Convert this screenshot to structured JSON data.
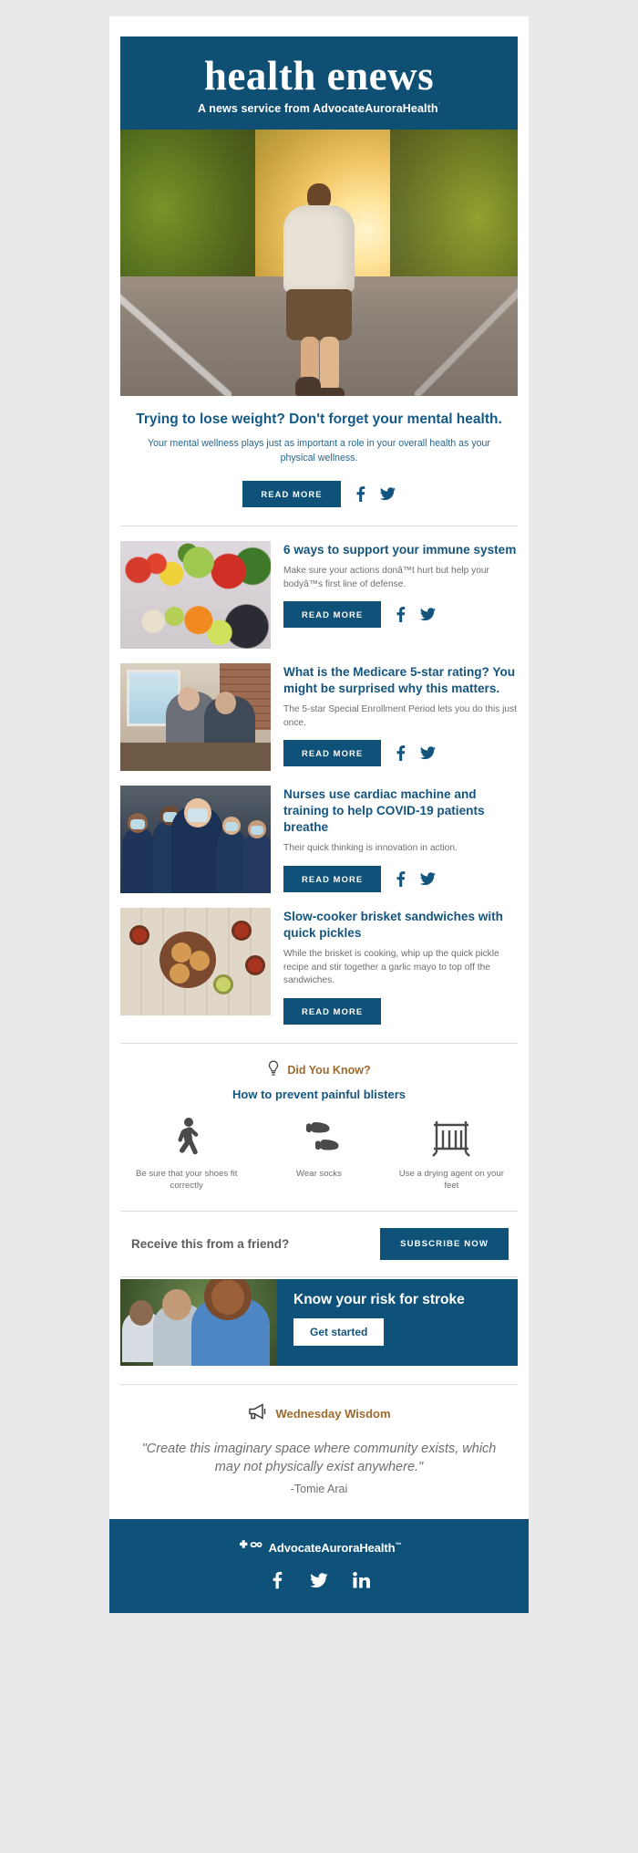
{
  "masthead": {
    "title": "health enews",
    "subtitle_prefix": "A news service from ",
    "brand": "AdvocateAuroraHealth",
    "tm": "˙"
  },
  "hero": {
    "image_alt": "man walking on a tree-lined road at sunset",
    "title": "Trying to lose weight? Don't forget your mental health.",
    "description": "Your mental wellness plays just as important a role in your overall health as your physical wellness.",
    "read_more": "READ MORE",
    "facebook_icon": "facebook-icon",
    "twitter_icon": "twitter-icon"
  },
  "articles": [
    {
      "image_alt": "assorted fresh vegetables and fruit",
      "title": "6 ways to support your immune system",
      "description": "Make sure your actions donâ™t hurt but help your bodyâ™s first line of defense.",
      "read_more": "READ MORE",
      "has_social": true
    },
    {
      "image_alt": "older couple at kitchen counter",
      "title": "What is the Medicare 5-star rating? You might be surprised why this matters.",
      "description": "The 5-star Special Enrollment Period lets you do this just once.",
      "read_more": "READ MORE",
      "has_social": true
    },
    {
      "image_alt": "group of nurses wearing masks",
      "title": "Nurses use cardiac machine and training to help COVID-19 patients breathe",
      "description": "Their quick thinking is innovation in action.",
      "read_more": "READ MORE",
      "has_social": true
    },
    {
      "image_alt": "brisket sandwiches on a wooden board",
      "title": "Slow-cooker brisket sandwiches with quick pickles",
      "description": "While the brisket is cooking, whip up the quick pickle recipe and stir together a garlic mayo to top off the sandwiches.",
      "read_more": "READ MORE",
      "has_social": false
    }
  ],
  "did_you_know": {
    "icon": "lightbulb-icon",
    "label": "Did You Know?",
    "title": "How to prevent painful blisters",
    "tips": [
      {
        "icon": "walking-person-icon",
        "caption": "Be sure that your shoes fit correctly"
      },
      {
        "icon": "footprints-icon",
        "caption": "Wear socks"
      },
      {
        "icon": "drying-rack-icon",
        "caption": "Use a drying agent on your feet"
      }
    ]
  },
  "subscribe": {
    "text": "Receive this from a friend?",
    "button": "SUBSCRIBE NOW"
  },
  "banner": {
    "image_alt": "three people laughing outdoors",
    "title": "Know your risk for stroke",
    "button": "Get started"
  },
  "wisdom": {
    "icon": "megaphone-icon",
    "label": "Wednesday Wisdom",
    "quote": "\"Create this imaginary space where community exists, which may not physically exist anywhere.\"",
    "author": "-Tomie Arai"
  },
  "footer": {
    "logo_icon": "advocate-aurora-cross-icon",
    "logo_text": "AdvocateAuroraHealth",
    "tm": "™",
    "social": [
      {
        "icon": "facebook-icon",
        "name": "facebook"
      },
      {
        "icon": "twitter-icon",
        "name": "twitter"
      },
      {
        "icon": "linkedin-icon",
        "name": "linkedin"
      }
    ]
  },
  "colors": {
    "brand_blue": "#0f5279",
    "masthead_blue": "#0f4f74",
    "title_blue": "#14557f",
    "gold": "#9e6a2e",
    "body_gray": "#6e6e6e"
  }
}
